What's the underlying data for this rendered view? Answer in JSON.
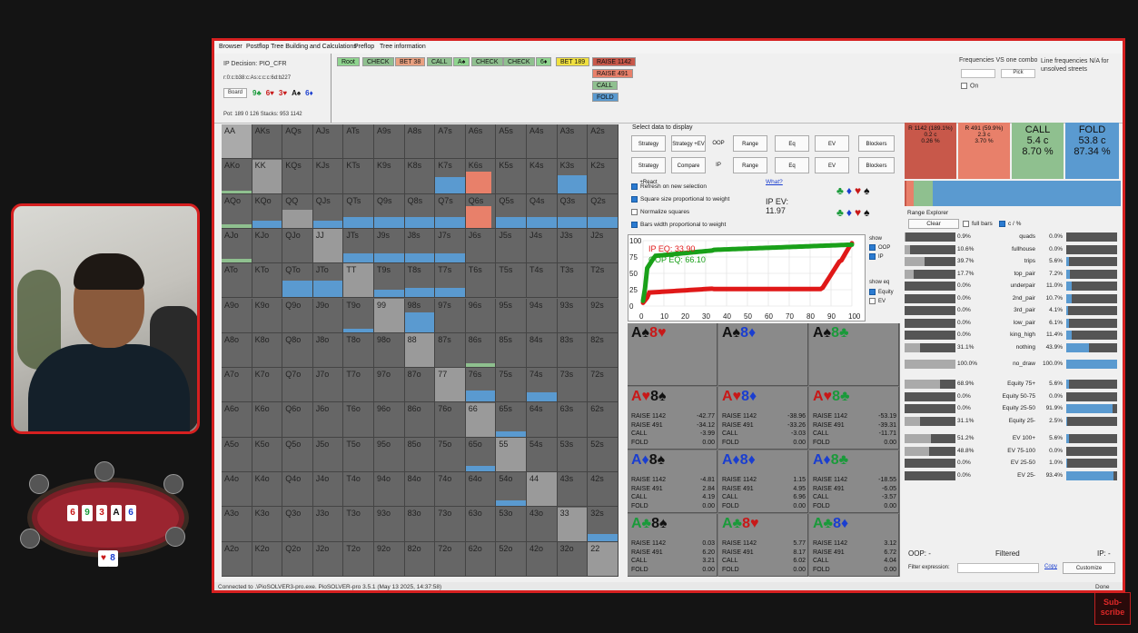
{
  "menu": [
    "Browser",
    "Postflop Tree Building and Calculations",
    "Preflop",
    "Tree information"
  ],
  "decision": {
    "label": "IP Decision:",
    "value": "PIO_CFR",
    "line": "r:0:c:b38:c:As:c:c:c:6d:b227",
    "board_btn": "Board",
    "board": [
      {
        "t": "9♣",
        "c": "#1a9a3a"
      },
      {
        "t": "6♥",
        "c": "#c81818"
      },
      {
        "t": "3♥",
        "c": "#c81818"
      },
      {
        "t": "A♠",
        "c": "#111"
      },
      {
        "t": "6♦",
        "c": "#1a3ed0"
      }
    ],
    "pot": "Pot: 189 0 126 Stacks: 953 1142"
  },
  "actions": [
    {
      "t": "Root",
      "bg": "#8fd48f"
    },
    {
      "t": "CHECK",
      "bg": "#8fc08f"
    },
    {
      "t": "BET 38",
      "bg": "#e8a080"
    },
    {
      "t": "CALL",
      "bg": "#8fc08f"
    },
    {
      "t": "A♠",
      "bg": "#8fd48f"
    },
    {
      "t": "CHECK",
      "bg": "#8fc08f"
    },
    {
      "t": "CHECK",
      "bg": "#8fc08f"
    },
    {
      "t": "6♦",
      "bg": "#8fd48f"
    },
    {
      "t": "BET 189",
      "bg": "#f0e040"
    }
  ],
  "options": [
    {
      "t": "RAISE 1142",
      "bg": "#c8584a"
    },
    {
      "t": "RAISE 491",
      "bg": "#e8806a"
    },
    {
      "t": "CALL",
      "bg": "#8fc08f"
    },
    {
      "t": "FOLD",
      "bg": "#5a9ad0"
    }
  ],
  "freq": {
    "title": "Frequencies VS one combo",
    "pick": "Pick",
    "on": "On",
    "note": "Line frequencies N/A for unsolved streets"
  },
  "grid": [
    [
      "AA",
      "AKs",
      "AQs",
      "AJs",
      "ATs",
      "A9s",
      "A8s",
      "A7s",
      "A6s",
      "A5s",
      "A4s",
      "A3s",
      "A2s"
    ],
    [
      "AKo",
      "KK",
      "KQs",
      "KJs",
      "KTs",
      "K9s",
      "K8s",
      "K7s",
      "K6s",
      "K5s",
      "K4s",
      "K3s",
      "K2s"
    ],
    [
      "AQo",
      "KQo",
      "QQ",
      "QJs",
      "QTs",
      "Q9s",
      "Q8s",
      "Q7s",
      "Q6s",
      "Q5s",
      "Q4s",
      "Q3s",
      "Q2s"
    ],
    [
      "AJo",
      "KJo",
      "QJo",
      "JJ",
      "JTs",
      "J9s",
      "J8s",
      "J7s",
      "J6s",
      "J5s",
      "J4s",
      "J3s",
      "J2s"
    ],
    [
      "ATo",
      "KTo",
      "QTo",
      "JTo",
      "TT",
      "T9s",
      "T8s",
      "T7s",
      "T6s",
      "T5s",
      "T4s",
      "T3s",
      "T2s"
    ],
    [
      "A9o",
      "K9o",
      "Q9o",
      "J9o",
      "T9o",
      "99",
      "98s",
      "97s",
      "96s",
      "95s",
      "94s",
      "93s",
      "92s"
    ],
    [
      "A8o",
      "K8o",
      "Q8o",
      "J8o",
      "T8o",
      "98o",
      "88",
      "87s",
      "86s",
      "85s",
      "84s",
      "83s",
      "82s"
    ],
    [
      "A7o",
      "K7o",
      "Q7o",
      "J7o",
      "T7o",
      "97o",
      "87o",
      "77",
      "76s",
      "75s",
      "74s",
      "73s",
      "72s"
    ],
    [
      "A6o",
      "K6o",
      "Q6o",
      "J6o",
      "T6o",
      "96o",
      "86o",
      "76o",
      "66",
      "65s",
      "64s",
      "63s",
      "62s"
    ],
    [
      "A5o",
      "K5o",
      "Q5o",
      "J5o",
      "T5o",
      "95o",
      "85o",
      "75o",
      "65o",
      "55",
      "54s",
      "53s",
      "52s"
    ],
    [
      "A4o",
      "K4o",
      "Q4o",
      "J4o",
      "T4o",
      "94o",
      "84o",
      "74o",
      "64o",
      "54o",
      "44",
      "43s",
      "42s"
    ],
    [
      "A3o",
      "K3o",
      "Q3o",
      "J3o",
      "T3o",
      "93o",
      "83o",
      "73o",
      "63o",
      "53o",
      "43o",
      "33",
      "32s"
    ],
    [
      "A2o",
      "K2o",
      "Q2o",
      "J2o",
      "T2o",
      "92o",
      "82o",
      "72o",
      "62o",
      "52o",
      "42o",
      "32o",
      "22"
    ]
  ],
  "select": {
    "title": "Select data to display",
    "row1": [
      "Strategy",
      "Strategy +EV",
      "OOP",
      "Range",
      "Eq",
      "EV",
      "Blockers"
    ],
    "row2": [
      "Strategy +React",
      "Compare",
      "IP",
      "Range",
      "Eq",
      "EV",
      "Blockers"
    ],
    "checks": [
      "Refresh on new selection",
      "Square size proportional to weight",
      "Normalize squares",
      "Bars width proportional to weight"
    ],
    "what": "What?",
    "ipev_label": "IP EV:",
    "ipev": "11.97"
  },
  "equity": {
    "ip": "IP EQ: 33.90",
    "oop": "OOP EQ: 66.10",
    "yticks": [
      "100",
      "75",
      "50",
      "25",
      "0"
    ],
    "xticks": [
      "0",
      "10",
      "20",
      "30",
      "40",
      "50",
      "60",
      "70",
      "80",
      "90",
      "100"
    ],
    "show": "show",
    "oop_chk": "OOP",
    "ip_chk": "IP",
    "show_eq": "show eq",
    "eq_chk": "Equity",
    "ev_chk": "EV"
  },
  "combos": [
    {
      "cards": [
        {
          "t": "A♠",
          "c": "ck"
        },
        {
          "t": "8♥",
          "c": "cr"
        }
      ],
      "stats": []
    },
    {
      "cards": [
        {
          "t": "A♠",
          "c": "ck"
        },
        {
          "t": "8♦",
          "c": "cb"
        }
      ],
      "stats": []
    },
    {
      "cards": [
        {
          "t": "A♠",
          "c": "ck"
        },
        {
          "t": "8♣",
          "c": "cg"
        }
      ],
      "stats": []
    },
    {
      "cards": [
        {
          "t": "A♥",
          "c": "cr"
        },
        {
          "t": "8♠",
          "c": "ck"
        }
      ],
      "stats": [
        [
          "RAISE 1142",
          "-42.77"
        ],
        [
          "RAISE 491",
          "-34.12"
        ],
        [
          "CALL",
          "-3.99"
        ],
        [
          "FOLD",
          "0.00"
        ]
      ]
    },
    {
      "cards": [
        {
          "t": "A♥",
          "c": "cr"
        },
        {
          "t": "8♦",
          "c": "cb"
        }
      ],
      "stats": [
        [
          "RAISE 1142",
          "-38.96"
        ],
        [
          "RAISE 491",
          "-33.26"
        ],
        [
          "CALL",
          "-3.03"
        ],
        [
          "FOLD",
          "0.00"
        ]
      ]
    },
    {
      "cards": [
        {
          "t": "A♥",
          "c": "cr"
        },
        {
          "t": "8♣",
          "c": "cg"
        }
      ],
      "stats": [
        [
          "RAISE 1142",
          "-53.19"
        ],
        [
          "RAISE 491",
          "-39.31"
        ],
        [
          "CALL",
          "-11.71"
        ],
        [
          "FOLD",
          "0.00"
        ]
      ]
    },
    {
      "cards": [
        {
          "t": "A♦",
          "c": "cb"
        },
        {
          "t": "8♠",
          "c": "ck"
        }
      ],
      "stats": [
        [
          "RAISE 1142",
          "-4.81"
        ],
        [
          "RAISE 491",
          "2.84"
        ],
        [
          "CALL",
          "4.19"
        ],
        [
          "FOLD",
          "0.00"
        ]
      ]
    },
    {
      "cards": [
        {
          "t": "A♦",
          "c": "cb"
        },
        {
          "t": "8♦",
          "c": "cb"
        }
      ],
      "stats": [
        [
          "RAISE 1142",
          "1.15"
        ],
        [
          "RAISE 491",
          "4.95"
        ],
        [
          "CALL",
          "6.96"
        ],
        [
          "FOLD",
          "0.00"
        ]
      ]
    },
    {
      "cards": [
        {
          "t": "A♦",
          "c": "cb"
        },
        {
          "t": "8♣",
          "c": "cg"
        }
      ],
      "stats": [
        [
          "RAISE 1142",
          "-18.55"
        ],
        [
          "RAISE 491",
          "-6.05"
        ],
        [
          "CALL",
          "-3.57"
        ],
        [
          "FOLD",
          "0.00"
        ]
      ]
    },
    {
      "cards": [
        {
          "t": "A♣",
          "c": "cg"
        },
        {
          "t": "8♠",
          "c": "ck"
        }
      ],
      "stats": [
        [
          "RAISE 1142",
          "0.03"
        ],
        [
          "RAISE 491",
          "6.20"
        ],
        [
          "CALL",
          "3.21"
        ],
        [
          "FOLD",
          "0.00"
        ]
      ]
    },
    {
      "cards": [
        {
          "t": "A♣",
          "c": "cg"
        },
        {
          "t": "8♥",
          "c": "cr"
        }
      ],
      "stats": [
        [
          "RAISE 1142",
          "5.77"
        ],
        [
          "RAISE 491",
          "8.17"
        ],
        [
          "CALL",
          "6.02"
        ],
        [
          "FOLD",
          "0.00"
        ]
      ]
    },
    {
      "cards": [
        {
          "t": "A♣",
          "c": "cg"
        },
        {
          "t": "8♦",
          "c": "cb"
        }
      ],
      "stats": [
        [
          "RAISE 1142",
          "3.12"
        ],
        [
          "RAISE 491",
          "6.72"
        ],
        [
          "CALL",
          "4.04"
        ],
        [
          "FOLD",
          "0.00"
        ]
      ]
    }
  ],
  "summary": [
    {
      "l1": "R 1142 (189.1%)",
      "l2": "0.2 c",
      "l3": "0.26 %",
      "bg": "#c8584a",
      "big": false
    },
    {
      "l1": "R 491 (59.9%)",
      "l2": "2.3 c",
      "l3": "3.70 %",
      "bg": "#e8806a",
      "big": false
    },
    {
      "l1": "CALL",
      "l2": "5.4 c",
      "l3": "8.70 %",
      "bg": "#8fc08f",
      "big": true
    },
    {
      "l1": "FOLD",
      "l2": "53.8 c",
      "l3": "87.34 %",
      "bg": "#5a9ad0",
      "big": true
    }
  ],
  "rangeexp": {
    "title": "Range Explorer",
    "clear": "Clear",
    "fullbars": "full bars",
    "cpct": "c / %"
  },
  "rows1": [
    [
      "0.9%",
      "quads",
      "0.0%"
    ],
    [
      "10.6%",
      "fullhouse",
      "0.0%"
    ],
    [
      "39.7%",
      "trips",
      "5.6%"
    ],
    [
      "17.7%",
      "top_pair",
      "7.2%"
    ],
    [
      "0.0%",
      "underpair",
      "11.0%"
    ],
    [
      "0.0%",
      "2nd_pair",
      "10.7%"
    ],
    [
      "0.0%",
      "3rd_pair",
      "4.1%"
    ],
    [
      "0.0%",
      "low_pair",
      "6.1%"
    ],
    [
      "0.0%",
      "king_high",
      "11.4%"
    ],
    [
      "31.1%",
      "nothing",
      "43.9%"
    ]
  ],
  "rows2": [
    [
      "100.0%",
      "no_draw",
      "100.0%"
    ]
  ],
  "rows3": [
    [
      "68.9%",
      "Equity 75+",
      "5.6%"
    ],
    [
      "0.0%",
      "Equity 50-75",
      "0.0%"
    ],
    [
      "0.0%",
      "Equity 25-50",
      "91.9%"
    ],
    [
      "31.1%",
      "Equity 25-",
      "2.5%"
    ]
  ],
  "rows4": [
    [
      "51.2%",
      "EV 100+",
      "5.6%"
    ],
    [
      "48.8%",
      "EV 75-100",
      "0.0%"
    ],
    [
      "0.0%",
      "EV 25-50",
      "1.0%"
    ],
    [
      "0.0%",
      "EV 25-",
      "93.4%"
    ]
  ],
  "footer": {
    "oop": "OOP: -",
    "filtered": "Filtered",
    "ip": "IP: -",
    "filter": "Filter expression:",
    "copy": "Copy",
    "customize": "Customize"
  },
  "status": {
    "text": "Connected to .\\PioSOLVER3-pro.exe. PioSOLVER-pro 3.5.1 (May 13 2025, 14:37:58)",
    "done": "Done"
  },
  "stream": {
    "subscribe": "Sub-scribe"
  },
  "table_cards": [
    {
      "t": "6",
      "c": "#c81818"
    },
    {
      "t": "9",
      "c": "#1a9a3a"
    },
    {
      "t": "3",
      "c": "#c81818"
    },
    {
      "t": "A",
      "c": "#111"
    },
    {
      "t": "6",
      "c": "#1a3ed0"
    }
  ]
}
